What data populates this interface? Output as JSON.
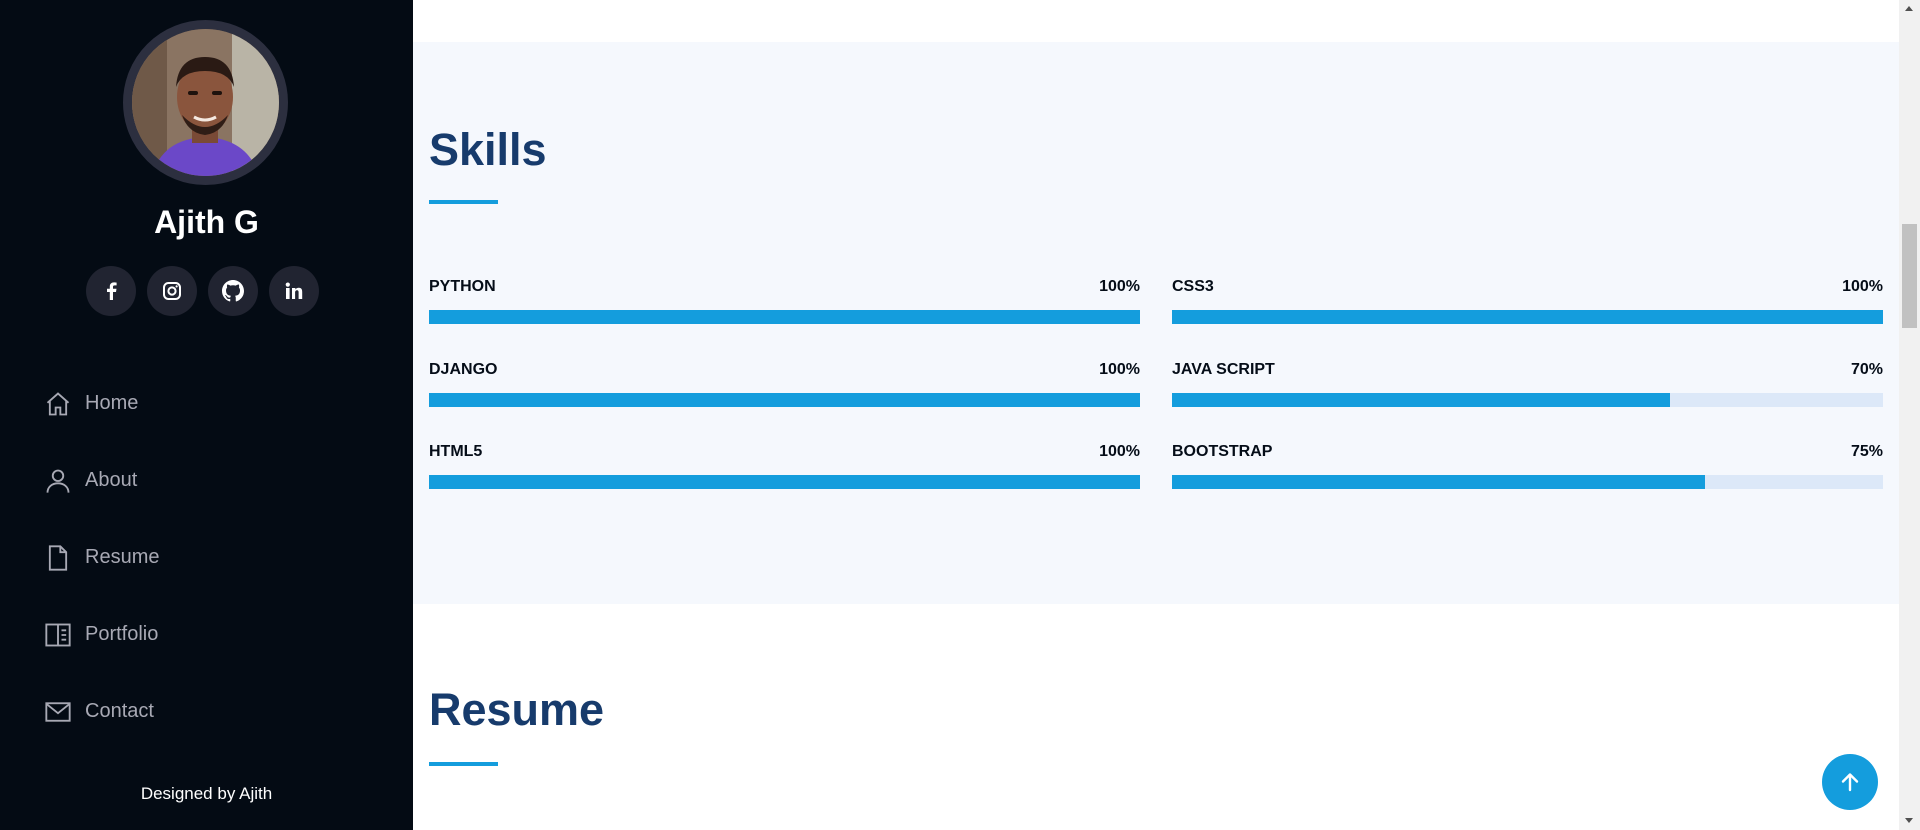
{
  "sidebar": {
    "profile_name": "Ajith G",
    "social": [
      {
        "icon": "facebook-icon",
        "label": "f"
      },
      {
        "icon": "instagram-icon",
        "label": ""
      },
      {
        "icon": "github-icon",
        "label": ""
      },
      {
        "icon": "linkedin-icon",
        "label": "in"
      }
    ],
    "nav": [
      {
        "label": "Home",
        "icon": "home-icon"
      },
      {
        "label": "About",
        "icon": "person-icon"
      },
      {
        "label": "Resume",
        "icon": "file-icon"
      },
      {
        "label": "Portfolio",
        "icon": "book-icon"
      },
      {
        "label": "Contact",
        "icon": "envelope-icon"
      }
    ],
    "footer": "Designed by Ajith"
  },
  "skills": {
    "title": "Skills",
    "items": [
      {
        "name": "PYTHON",
        "percent_label": "100%",
        "value": 100
      },
      {
        "name": "CSS3",
        "percent_label": "100%",
        "value": 100
      },
      {
        "name": "DJANGO",
        "percent_label": "100%",
        "value": 100
      },
      {
        "name": "JAVA SCRIPT",
        "percent_label": "70%",
        "value": 70
      },
      {
        "name": "HTML5",
        "percent_label": "100%",
        "value": 100
      },
      {
        "name": "BOOTSTRAP",
        "percent_label": "75%",
        "value": 75
      }
    ]
  },
  "resume": {
    "title": "Resume"
  },
  "colors": {
    "accent": "#149ddd",
    "heading": "#173b6c",
    "sidebar_bg": "#040b14",
    "section_bg": "#f5f8fd"
  }
}
